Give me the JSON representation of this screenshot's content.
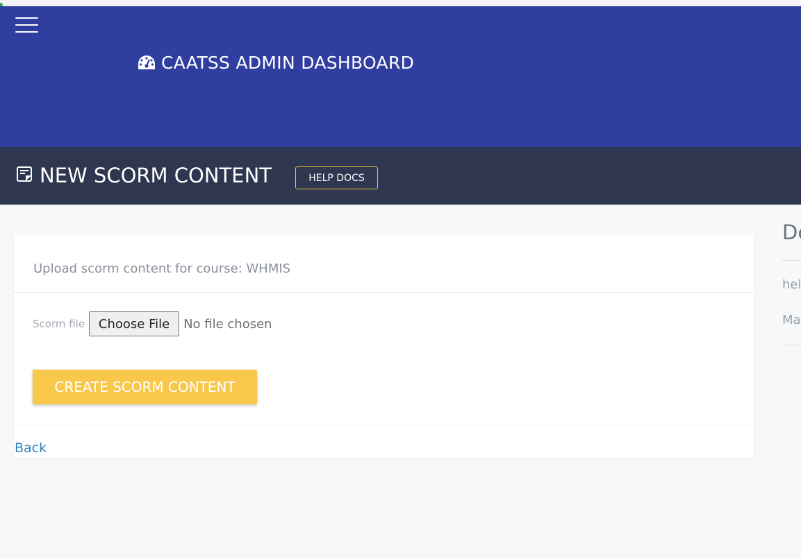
{
  "header": {
    "title": "CAATSS ADMIN DASHBOARD",
    "title_icon": "gauge-icon",
    "background_color": "#303ea0"
  },
  "page": {
    "heading": "NEW SCORM CONTENT",
    "heading_icon": "note-icon",
    "help_label": "HELP DOCS",
    "bar_color": "#2e374f"
  },
  "form": {
    "subtitle": "Upload scorm content for course: WHMIS",
    "file_label": "Scorm file",
    "choose_label": "Choose File",
    "file_status": "No file chosen",
    "submit_label": "CREATE SCORM CONTENT",
    "submit_color": "#f9c84a"
  },
  "back_label": "Back",
  "side": {
    "title": "De",
    "line1": "hel",
    "line2": "Ma"
  }
}
